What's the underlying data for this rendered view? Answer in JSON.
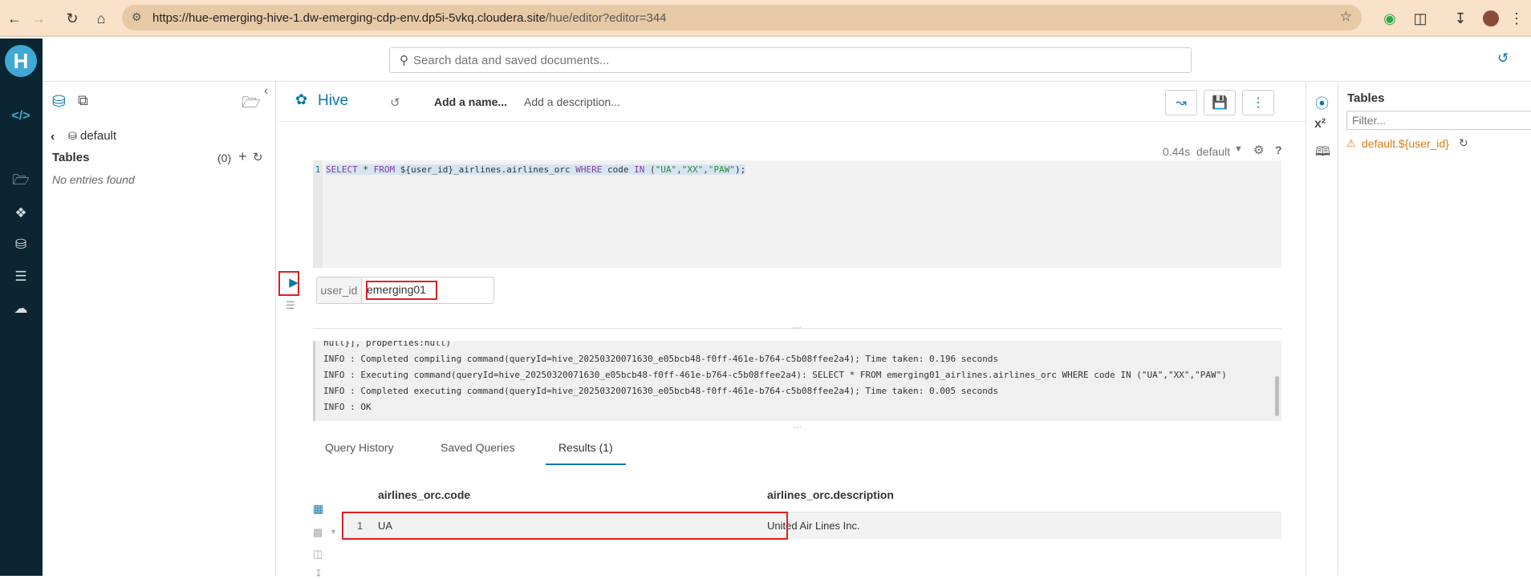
{
  "browser": {
    "url_host": "https://hue-emerging-hive-1.dw-emerging-cdp-env.dp5i-5vkq.cloudera.site",
    "url_path": "/hue/editor?editor=344"
  },
  "header": {
    "search_placeholder": "Search data and saved documents..."
  },
  "assist": {
    "database": "default",
    "tables_label": "Tables",
    "tables_count": "(0)",
    "empty_text": "No entries found"
  },
  "editor": {
    "engine": "Hive",
    "name_placeholder": "Add a name...",
    "description_placeholder": "Add a description...",
    "exec_time": "0.44s",
    "db": "default",
    "line_number": "1",
    "query_parts": {
      "p1": "SELECT",
      "p2": " * ",
      "p3": "FROM",
      "p4": " ${user_id}_airlines.airlines_orc ",
      "p5": "WHERE",
      "p6": " code ",
      "p7": "IN",
      "p8": " (",
      "p9": "\"UA\"",
      "p10": ",",
      "p11": "\"XX\"",
      "p12": ",",
      "p13": "\"PAW\"",
      "p14": ");"
    },
    "param_label": "user_id",
    "param_value": "emerging01"
  },
  "logs": [
    "null}], properties:null)",
    "INFO  : Completed compiling command(queryId=hive_20250320071630_e05bcb48-f0ff-461e-b764-c5b08ffee2a4); Time taken: 0.196 seconds",
    "INFO  : Executing command(queryId=hive_20250320071630_e05bcb48-f0ff-461e-b764-c5b08ffee2a4): SELECT * FROM emerging01_airlines.airlines_orc WHERE code IN (\"UA\",\"XX\",\"PAW\")",
    "INFO  : Completed executing command(queryId=hive_20250320071630_e05bcb48-f0ff-461e-b764-c5b08ffee2a4); Time taken: 0.005 seconds",
    "INFO  : OK"
  ],
  "tabs": [
    "Query History",
    "Saved Queries",
    "Results (1)"
  ],
  "results": {
    "columns": [
      "airlines_orc.code",
      "airlines_orc.description"
    ],
    "rows": [
      {
        "index": "1",
        "code": "UA",
        "description": "United Air Lines Inc."
      }
    ]
  },
  "right_panel": {
    "title": "Tables",
    "filter_placeholder": "Filter...",
    "warning_table": "default.${user_id}"
  },
  "colors": {
    "rail": "#0c2533",
    "accent": "#0a78a8",
    "highlight": "#e01f1f",
    "warning": "#e07a12"
  }
}
